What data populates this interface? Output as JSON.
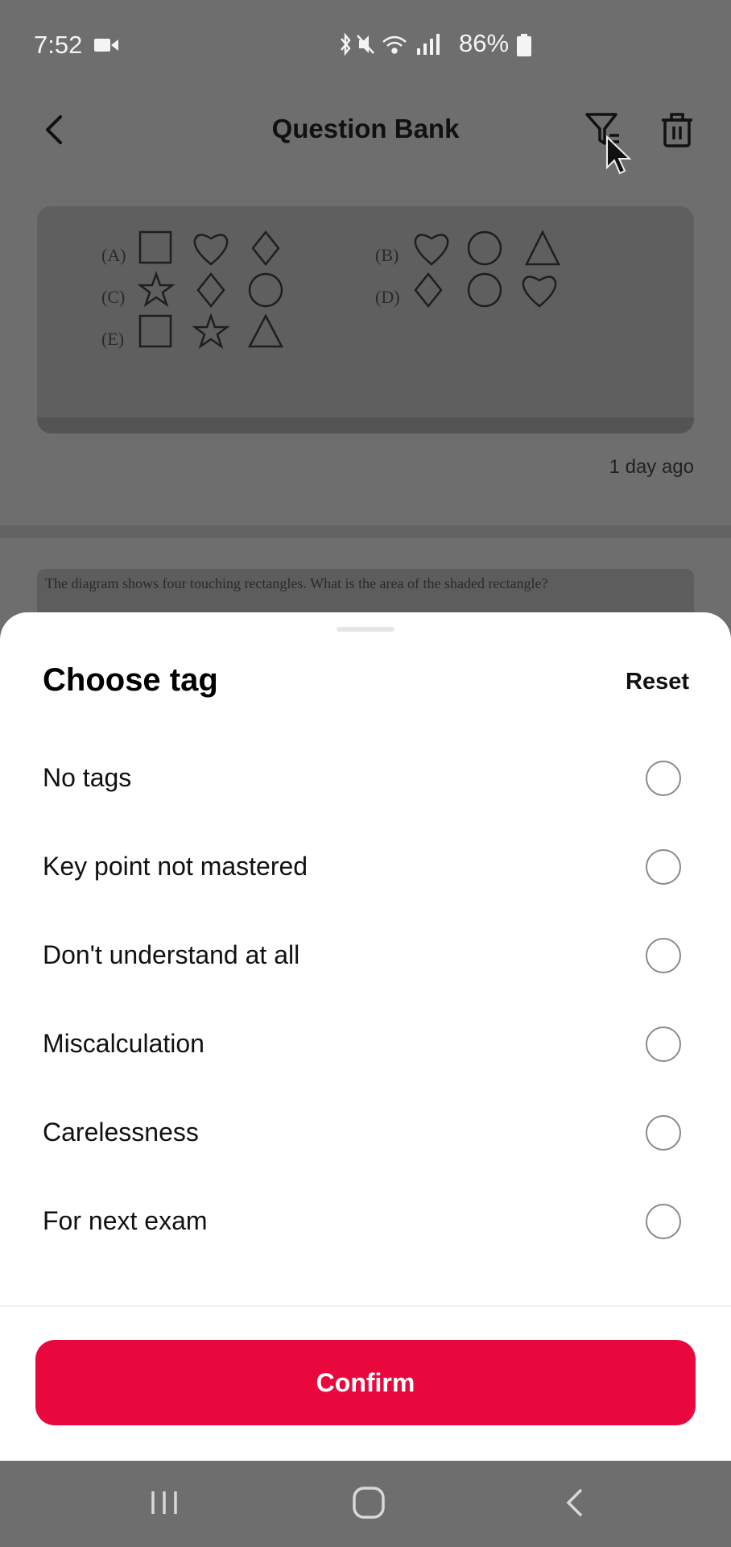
{
  "status_bar": {
    "time": "7:52",
    "battery": "86%"
  },
  "app_bar": {
    "title": "Question Bank"
  },
  "question_card": {
    "timestamp": "1 day ago",
    "options": [
      "(A)",
      "(B)",
      "(C)",
      "(D)",
      "(E)"
    ]
  },
  "question_card_2": {
    "text": "The diagram shows four touching rectangles. What is the area of the shaded rectangle?"
  },
  "sheet": {
    "title": "Choose tag",
    "reset_label": "Reset",
    "tags": [
      {
        "label": "No tags"
      },
      {
        "label": "Key point not mastered"
      },
      {
        "label": "Don't understand at all"
      },
      {
        "label": "Miscalculation"
      },
      {
        "label": "Carelessness"
      },
      {
        "label": "For next exam"
      }
    ],
    "confirm_label": "Confirm"
  },
  "colors": {
    "accent": "#e8083d",
    "scrim": "#6e6e6e"
  }
}
